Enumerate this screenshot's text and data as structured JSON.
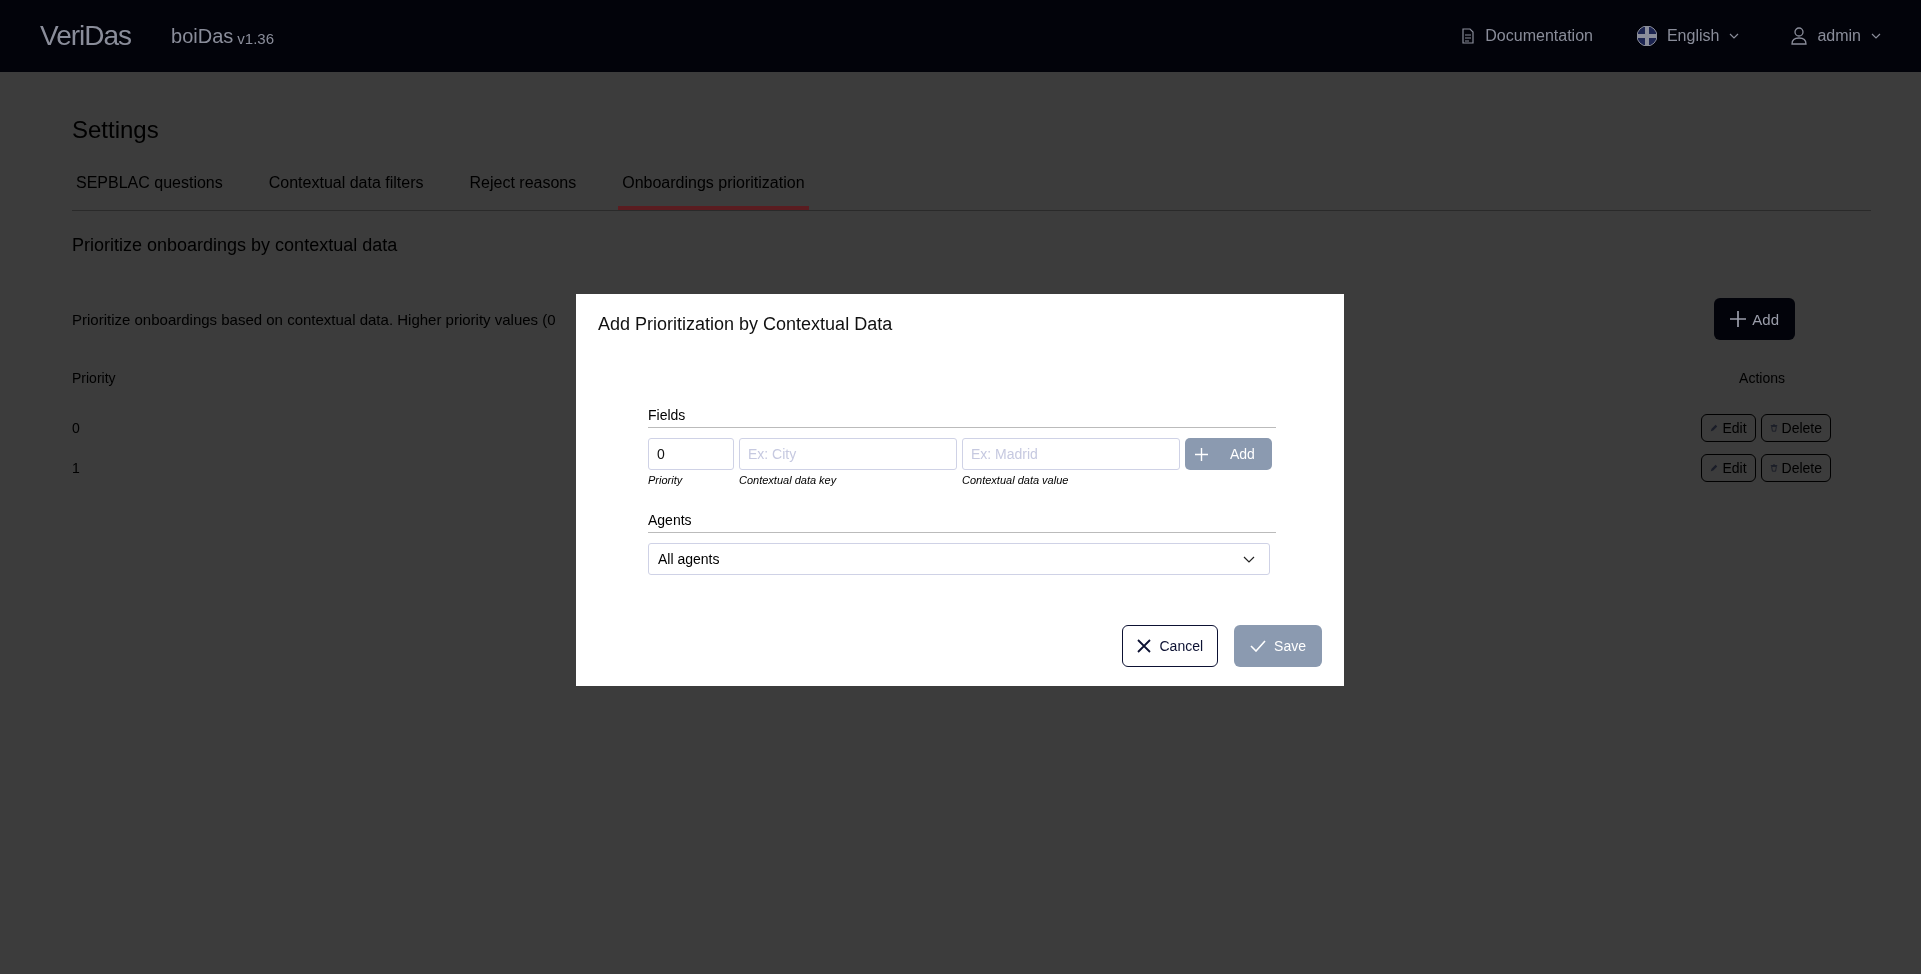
{
  "header": {
    "logo": "VeriDas",
    "product": "boiDas",
    "version": "v1.36",
    "documentation": "Documentation",
    "language": "English",
    "user": "admin"
  },
  "page": {
    "title": "Settings",
    "tabs": [
      {
        "label": "SEPBLAC questions",
        "selected": false
      },
      {
        "label": "Contextual data filters",
        "selected": false
      },
      {
        "label": "Reject reasons",
        "selected": false
      },
      {
        "label": "Onboardings prioritization",
        "selected": true
      }
    ],
    "section_title": "Prioritize onboardings by contextual data",
    "description": "Prioritize onboardings based on contextual data. Higher priority values (0",
    "add_button": "Add",
    "table": {
      "columns": [
        "Priority",
        "Actions"
      ],
      "rows": [
        {
          "priority": "0",
          "edit": "Edit",
          "delete": "Delete"
        },
        {
          "priority": "1",
          "edit": "Edit",
          "delete": "Delete"
        }
      ]
    }
  },
  "modal": {
    "title": "Add Prioritization by Contextual Data",
    "fields_label": "Fields",
    "priority": {
      "value": "0",
      "caption": "Priority"
    },
    "key": {
      "placeholder": "Ex: City",
      "caption": "Contextual data key"
    },
    "value": {
      "placeholder": "Ex: Madrid",
      "caption": "Contextual data value"
    },
    "add_button": {
      "label": "Add",
      "disabled": true
    },
    "agents_label": "Agents",
    "agents_select": "All agents",
    "cancel": "Cancel",
    "save": {
      "label": "Save",
      "disabled": true
    }
  }
}
